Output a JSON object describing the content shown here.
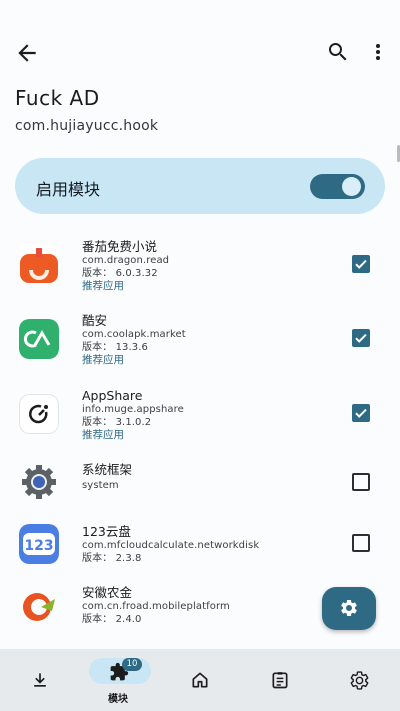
{
  "topbar": {
    "back_icon": "arrow-back-icon",
    "search_icon": "search-icon",
    "more_icon": "more-vert-icon"
  },
  "header": {
    "title": "Fuck AD",
    "subtitle": "com.hujiayucc.hook"
  },
  "enable": {
    "label": "启用模块",
    "checked": true
  },
  "apps": [
    {
      "name": "番茄免费小说",
      "package": "com.dragon.read",
      "version": "版本： 6.0.3.32",
      "tag": "推荐应用",
      "checked": true,
      "icon": "fanqie-novel-icon"
    },
    {
      "name": "酷安",
      "package": "com.coolapk.market",
      "version": "版本： 13.3.6",
      "tag": "推荐应用",
      "checked": true,
      "icon": "coolapk-icon"
    },
    {
      "name": "AppShare",
      "package": "info.muge.appshare",
      "version": "版本： 3.1.0.2",
      "tag": "推荐应用",
      "checked": true,
      "icon": "appshare-icon"
    },
    {
      "name": "系统框架",
      "package": "system",
      "version": "",
      "tag": "",
      "checked": false,
      "icon": "system-framework-gear-icon"
    },
    {
      "name": "123云盘",
      "package": "com.mfcloudcalculate.networkdisk",
      "version": "版本： 2.3.8",
      "tag": "",
      "checked": false,
      "icon": "123pan-icon"
    },
    {
      "name": "安徽农金",
      "package": "com.cn.froad.mobileplatform",
      "version": "版本： 2.4.0",
      "tag": "",
      "checked": false,
      "icon": "anhui-rural-finance-icon"
    }
  ],
  "fab": {
    "icon": "settings-icon"
  },
  "bottom_nav": {
    "items": [
      {
        "icon": "download-icon",
        "label": ""
      },
      {
        "icon": "puzzle-icon",
        "label": "模块",
        "badge": "10",
        "active": true
      },
      {
        "icon": "home-icon",
        "label": ""
      },
      {
        "icon": "log-icon",
        "label": ""
      },
      {
        "icon": "settings-icon",
        "label": ""
      }
    ]
  },
  "colors": {
    "accent": "#2f6a85",
    "card": "#c9e6f5",
    "nav_bg": "#e6eaed"
  }
}
